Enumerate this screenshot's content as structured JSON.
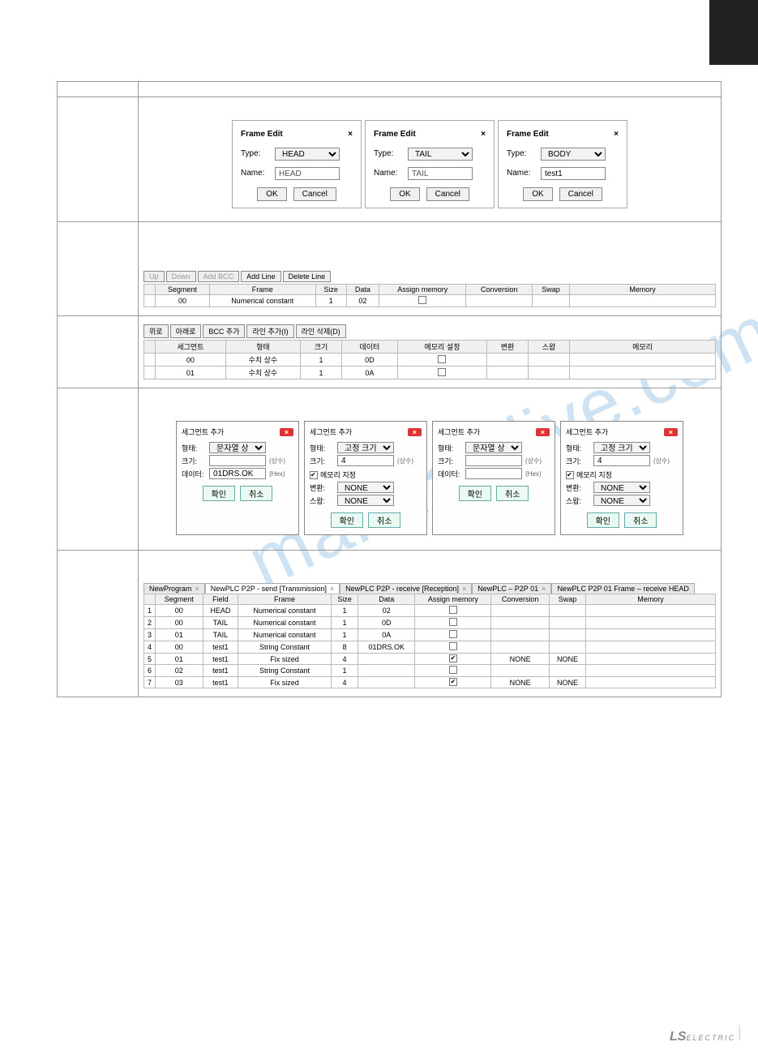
{
  "branding": {
    "logo_main": "LS",
    "logo_sub": "ELECTRIC"
  },
  "fe": {
    "title": "Frame Edit",
    "type_label": "Type:",
    "name_label": "Name:",
    "ok": "OK",
    "cancel": "Cancel",
    "dialogs": [
      {
        "type": "HEAD",
        "name": "HEAD"
      },
      {
        "type": "TAIL",
        "name": "TAIL"
      },
      {
        "type": "BODY",
        "name": "test1"
      }
    ]
  },
  "block1": {
    "toolbar": [
      "Up",
      "Down",
      "Add BCC",
      "Add Line",
      "Delete Line"
    ],
    "disabled": [
      0,
      1,
      2
    ],
    "cols": [
      "",
      "Segment",
      "Frame",
      "Size",
      "Data",
      "Assign memory",
      "Conversion",
      "Swap",
      "Memory"
    ],
    "rows": [
      {
        "seg": "00",
        "frame": "Numerical constant",
        "size": "1",
        "data": "02",
        "am": false,
        "conv": "",
        "swap": "",
        "mem": ""
      }
    ]
  },
  "block2": {
    "toolbar": [
      "위로",
      "아래로",
      "BCC 추가",
      "라인 추가(I)",
      "라인 삭제(D)"
    ],
    "cols": [
      "",
      "세그먼트",
      "형태",
      "크기",
      "데이터",
      "메모리 설정",
      "변환",
      "스왑",
      "메모리"
    ],
    "rows": [
      {
        "seg": "00",
        "frame": "수치 상수",
        "size": "1",
        "data": "0D",
        "am": false
      },
      {
        "seg": "01",
        "frame": "수치 상수",
        "size": "1",
        "data": "0A",
        "am": false
      }
    ]
  },
  "seg": {
    "title": "세그먼트 추가",
    "labels": {
      "type": "형태:",
      "size": "크기:",
      "data": "데이터:",
      "assign": "메모리 지정",
      "conv": "변환:",
      "swap": "스왑:"
    },
    "hints": {
      "const": "(상수)",
      "hex": "(Hex)"
    },
    "none": "NONE",
    "ok": "확인",
    "cancel": "취소",
    "dlg1": {
      "type": "문자열 상수",
      "size": "",
      "data": "01DRS.OK"
    },
    "dlg2": {
      "type": "고정 크기 변수",
      "size": "4"
    },
    "dlg3": {
      "type": "문자열 상수",
      "size": "",
      "data": ""
    },
    "dlg4": {
      "type": "고정 크기 변수",
      "size": "4"
    }
  },
  "tabs": [
    {
      "label": "NewProgram",
      "active": false
    },
    {
      "label": "NewPLC P2P - send [Transmission]",
      "active": true
    },
    {
      "label": "NewPLC P2P - receive [Reception]",
      "active": false
    },
    {
      "label": "NewPLC – P2P 01",
      "active": false
    },
    {
      "label": "NewPLC P2P 01 Frame – receive HEAD",
      "active": false
    }
  ],
  "bigtable": {
    "cols": [
      "",
      "Segment",
      "Field",
      "Frame",
      "Size",
      "Data",
      "Assign memory",
      "Conversion",
      "Swap",
      "Memory"
    ],
    "rows": [
      {
        "n": "1",
        "seg": "00",
        "field": "HEAD",
        "frame": "Numerical constant",
        "size": "1",
        "data": "02",
        "am": false,
        "conv": "",
        "swap": "",
        "mem": ""
      },
      {
        "n": "2",
        "seg": "00",
        "field": "TAIL",
        "frame": "Numerical constant",
        "size": "1",
        "data": "0D",
        "am": false,
        "conv": "",
        "swap": "",
        "mem": ""
      },
      {
        "n": "3",
        "seg": "01",
        "field": "TAIL",
        "frame": "Numerical constant",
        "size": "1",
        "data": "0A",
        "am": false,
        "conv": "",
        "swap": "",
        "mem": ""
      },
      {
        "n": "4",
        "seg": "00",
        "field": "test1",
        "frame": "String Constant",
        "size": "8",
        "data": "01DRS.OK",
        "am": false,
        "conv": "",
        "swap": "",
        "mem": ""
      },
      {
        "n": "5",
        "seg": "01",
        "field": "test1",
        "frame": "Fix sized",
        "size": "4",
        "data": "",
        "am": true,
        "conv": "NONE",
        "swap": "NONE",
        "mem": ""
      },
      {
        "n": "6",
        "seg": "02",
        "field": "test1",
        "frame": "String Constant",
        "size": "1",
        "data": "",
        "am": false,
        "conv": "",
        "swap": "",
        "mem": ""
      },
      {
        "n": "7",
        "seg": "03",
        "field": "test1",
        "frame": "Fix sized",
        "size": "4",
        "data": "",
        "am": true,
        "conv": "NONE",
        "swap": "NONE",
        "mem": ""
      }
    ]
  }
}
